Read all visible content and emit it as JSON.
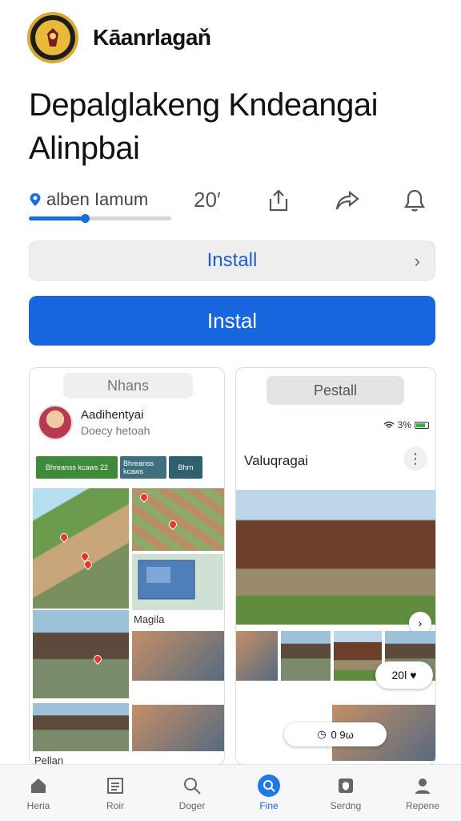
{
  "header": {
    "app_name": "Kāanrlagaň"
  },
  "title": [
    "Depalglakeng Kndeangai",
    "Alinpbai"
  ],
  "meta": {
    "location": "alben Iamum",
    "count": "20′",
    "progress": 0.4
  },
  "buttons": {
    "secondary": "Install",
    "primary": "Instal"
  },
  "screenshots": {
    "left": {
      "pill": "Nhans",
      "profile_name": "Aadihentyai",
      "profile_sub": "Doecy hetoah",
      "chips": [
        {
          "text": "Bhreanss kcaws 22",
          "color": "#3f8a3a"
        },
        {
          "text": "Bhreanss kcaws",
          "color": "#3f6f7e"
        },
        {
          "text": "Bhrn",
          "color": "#2f6070"
        }
      ],
      "captions": {
        "map": "Magila",
        "bottom": "Pellan"
      }
    },
    "right": {
      "pill": "Pestall",
      "status": "3%",
      "title": "Valuqragai",
      "fav": "20l",
      "timer": "0 9ω"
    }
  },
  "tabs": [
    {
      "label": "Heria",
      "icon": "home-icon"
    },
    {
      "label": "Roir",
      "icon": "list-icon"
    },
    {
      "label": "Doger",
      "icon": "search-icon"
    },
    {
      "label": "Fine",
      "icon": "map-icon",
      "active": true
    },
    {
      "label": "Serdng",
      "icon": "shield-icon"
    },
    {
      "label": "Repene",
      "icon": "user-icon"
    }
  ],
  "colors": {
    "accent": "#1566df",
    "logo_gold": "#e8b93a"
  }
}
